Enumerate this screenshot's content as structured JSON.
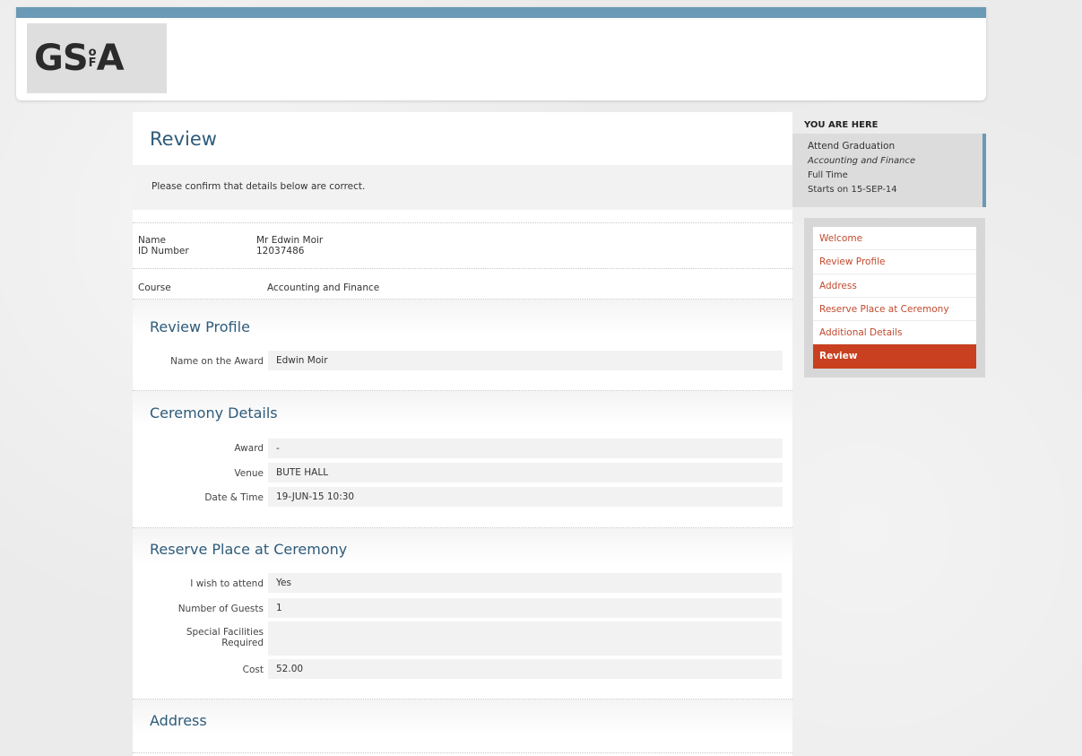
{
  "header": {
    "logo": {
      "left": "GS",
      "of_top": "o",
      "of_bottom": "F",
      "right": "A"
    }
  },
  "page": {
    "title": "Review",
    "notice": "Please confirm that details below are correct."
  },
  "student": {
    "name_label": "Name",
    "id_label": "ID Number",
    "name_value": "Mr Edwin Moir",
    "id_value": "12037486",
    "course_label": "Course",
    "course_value": "Accounting and Finance"
  },
  "review_profile": {
    "title": "Review Profile",
    "rows": [
      {
        "label": "Name on the Award",
        "value": "Edwin Moir"
      }
    ]
  },
  "ceremony": {
    "title": "Ceremony Details",
    "rows": [
      {
        "label": "Award",
        "value": "-"
      },
      {
        "label": "Venue",
        "value": "BUTE HALL"
      },
      {
        "label": "Date & Time",
        "value": "19-JUN-15 10:30"
      }
    ]
  },
  "reserve": {
    "title": "Reserve Place at Ceremony",
    "rows": [
      {
        "label": "I wish to attend",
        "value": "Yes"
      },
      {
        "label": "Number of Guests",
        "value": "1"
      },
      {
        "label_line1": "Special Facilities",
        "label_line2": "Required",
        "value": ""
      },
      {
        "label": "Cost",
        "value": "52.00"
      }
    ]
  },
  "address": {
    "title": "Address"
  },
  "sidebar": {
    "heading": "YOU ARE HERE",
    "context": {
      "line1": "Attend Graduation",
      "line2": "Accounting and Finance",
      "line3": "Full Time",
      "line4": "Starts on 15-SEP-14"
    },
    "nav": [
      {
        "label": "Welcome"
      },
      {
        "label": "Review Profile"
      },
      {
        "label": "Address"
      },
      {
        "label": "Reserve Place at Ceremony"
      },
      {
        "label": "Additional Details"
      },
      {
        "label": "Review"
      }
    ]
  },
  "colors": {
    "accent_blue": "#6a9ab5",
    "title_blue": "#2e5b7a",
    "nav_link": "#c24a2f",
    "nav_active": "#c8401f"
  }
}
